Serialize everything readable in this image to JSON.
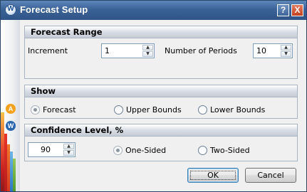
{
  "window": {
    "title": "Forecast Setup",
    "app_icon_letter": "W",
    "help_label": "?",
    "close_label": "X"
  },
  "sidebar": {
    "icons": [
      {
        "name": "warning-a-icon",
        "letter": "A",
        "color": "#f4a21d"
      },
      {
        "name": "weibull-w-icon",
        "letter": "W",
        "color": "#2a66b0"
      }
    ]
  },
  "forecast_range": {
    "title": "Forecast Range",
    "increment_label": "Increment",
    "increment_value": "1",
    "periods_label": "Number of Periods",
    "periods_value": "10"
  },
  "show": {
    "title": "Show",
    "options": [
      {
        "label": "Forecast",
        "checked": true
      },
      {
        "label": "Upper Bounds",
        "checked": false
      },
      {
        "label": "Lower Bounds",
        "checked": false
      }
    ]
  },
  "confidence": {
    "title": "Confidence Level, %",
    "value": "90",
    "options": [
      {
        "label": "One-Sided",
        "checked": true
      },
      {
        "label": "Two-Sided",
        "checked": false
      }
    ]
  },
  "buttons": {
    "ok": "OK",
    "cancel": "Cancel"
  }
}
